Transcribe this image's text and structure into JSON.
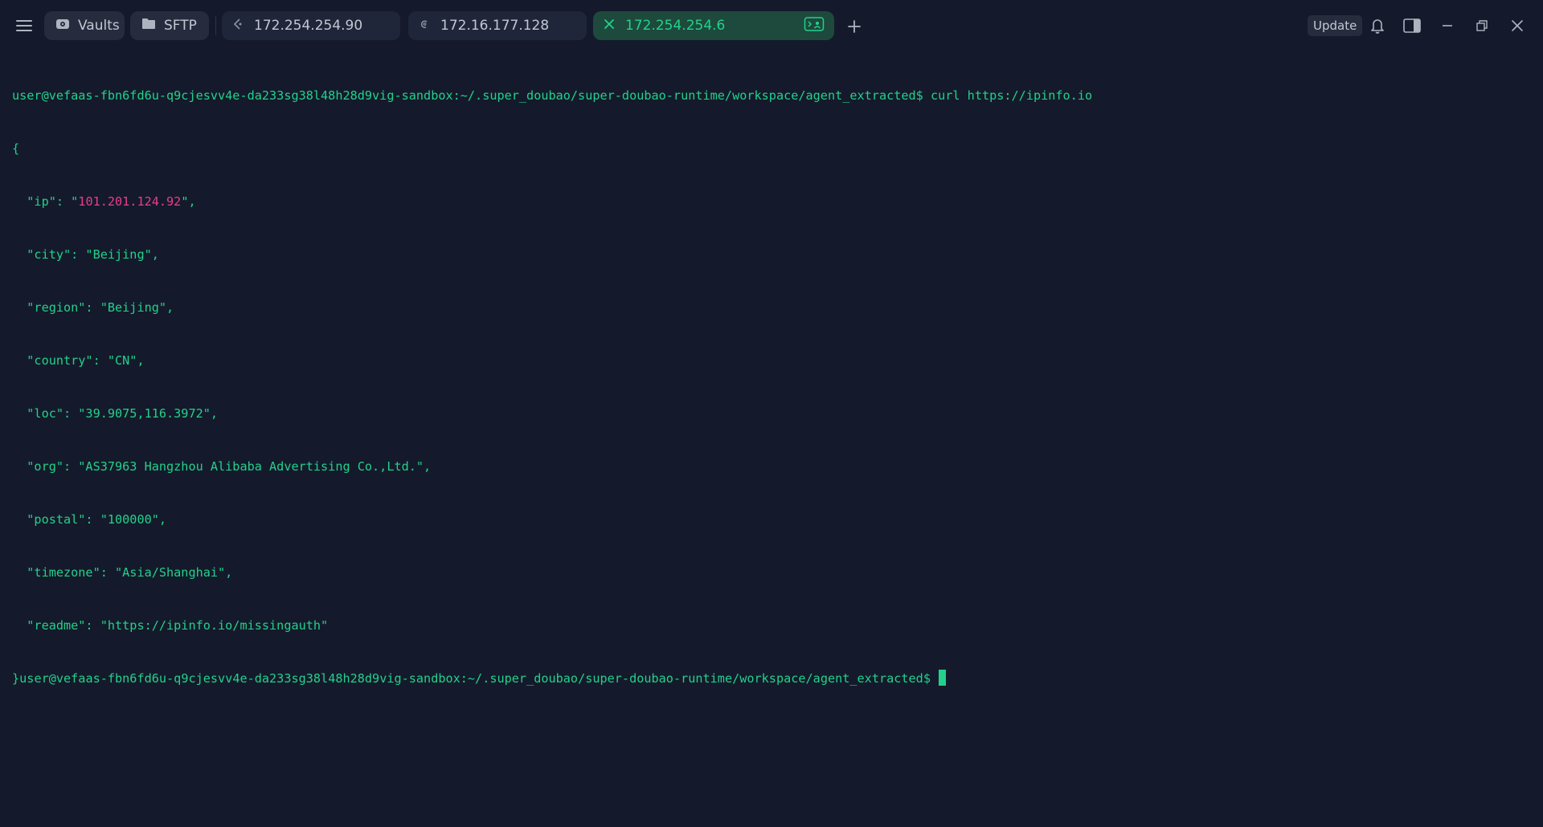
{
  "titlebar": {
    "vaults_label": "Vaults",
    "sftp_label": "SFTP",
    "tabs": [
      {
        "label": "172.254.254.90",
        "icon": "linux-distro-icon"
      },
      {
        "label": "172.16.177.128",
        "icon": "debian-icon"
      },
      {
        "label": "172.254.254.6",
        "icon": "close-icon",
        "active": true
      }
    ],
    "update_label": "Update"
  },
  "terminal": {
    "prompt_1": "user@vefaas-fbn6fd6u-q9cjesvv4e-da233sg38l48h28d9vig-sandbox:~/.super_doubao/super-doubao-runtime/workspace/agent_extracted$",
    "command_1": " curl https://ipinfo.io",
    "open_brace": "{",
    "ip_key": "  \"ip\": \"",
    "ip_value": "101.201.124.92",
    "ip_end": "\",",
    "json_lines": [
      "  \"city\": \"Beijing\",",
      "  \"region\": \"Beijing\",",
      "  \"country\": \"CN\",",
      "  \"loc\": \"39.9075,116.3972\",",
      "  \"org\": \"AS37963 Hangzhou Alibaba Advertising Co.,Ltd.\",",
      "  \"postal\": \"100000\",",
      "  \"timezone\": \"Asia/Shanghai\",",
      "  \"readme\": \"https://ipinfo.io/missingauth\""
    ],
    "close_brace": "}",
    "prompt_2": "user@vefaas-fbn6fd6u-q9cjesvv4e-da233sg38l48h28d9vig-sandbox:~/.super_doubao/super-doubao-runtime/workspace/agent_extracted$"
  },
  "colors": {
    "background": "#141a2b",
    "terminal_green": "#23d18b",
    "highlight_pink": "#e93d8f",
    "active_tab": "#1d4a3d"
  }
}
